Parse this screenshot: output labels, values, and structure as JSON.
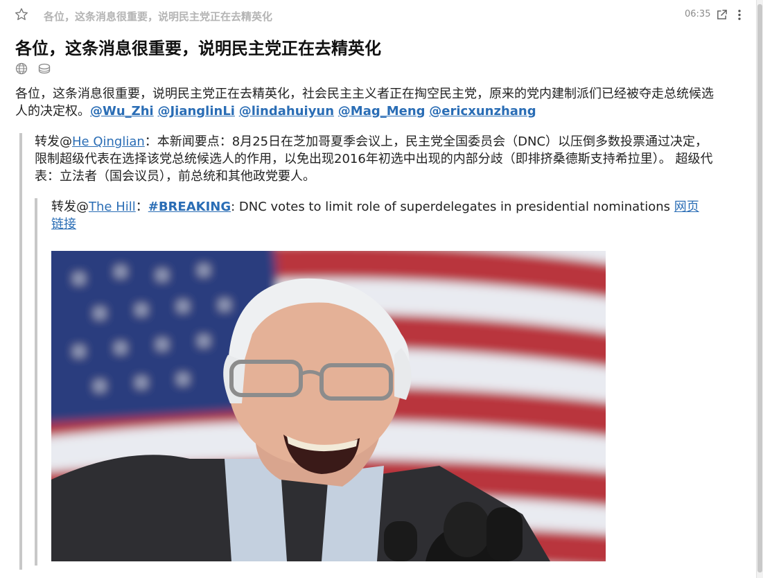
{
  "top_bar": {
    "title": "各位，这条消息很重要，说明民主党正在去精英化",
    "time": "06:35"
  },
  "post": {
    "title": "各位，这条消息很重要，说明民主党正在去精英化",
    "body": "各位，这条消息很重要，说明民主党正在去精英化，社会民主主义者正在掏空民主党，原来的党内建制派们已经被夺走总统候选人的决定权。",
    "mentions": [
      "@Wu_Zhi",
      "@JianglinLi",
      "@lindahuiyun",
      "@Mag_Meng",
      "@ericxunzhang"
    ]
  },
  "quote1": {
    "prefix": "转发@",
    "user": "He Qinglian",
    "text": "：本新闻要点：8月25日在芝加哥夏季会议上，民主党全国委员会（DNC）以压倒多数投票通过决定，限制超级代表在选择该党总统候选人的作用，以免出现2016年初选中出现的内部分歧（即排挤桑德斯支持希拉里）。 超级代表：立法者（国会议员），前总统和其他政党要人。"
  },
  "quote2": {
    "prefix": "转发@",
    "user": "The Hill",
    "separator": "：",
    "hashtag": "#BREAKING",
    "text": ": DNC votes to limit role of superdelegates in presidential nominations ",
    "link": "网页链接"
  },
  "icons": {
    "star": "star-outline-icon",
    "open": "open-external-icon",
    "more": "more-vertical-icon",
    "globe": "globe-icon",
    "db": "database-icon"
  },
  "colors": {
    "link": "#2a6db5",
    "muted": "#b4b4b4",
    "quote_border": "#c8c8c8"
  }
}
